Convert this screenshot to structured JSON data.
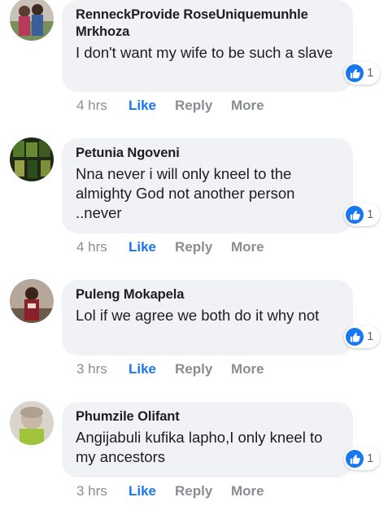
{
  "comments": [
    {
      "author": "RenneckProvide RoseUniquemunhle Mrkhoza",
      "text": "I don't want my wife to be such a slave",
      "reaction_count": "1",
      "time": "4 hrs",
      "like": "Like",
      "reply": "Reply",
      "more": "More"
    },
    {
      "author": "Petunia Ngoveni",
      "text": "Nna never i will only kneel to the almighty God not another person ..never",
      "reaction_count": "1",
      "time": "4 hrs",
      "like": "Like",
      "reply": "Reply",
      "more": "More"
    },
    {
      "author": "Puleng Mokapela",
      "text": "Lol if we agree we both do it why not",
      "reaction_count": "1",
      "time": "3 hrs",
      "like": "Like",
      "reply": "Reply",
      "more": "More"
    },
    {
      "author": "Phumzile Olifant",
      "text": "Angijabuli kufika lapho,I only kneel to my ancestors",
      "reaction_count": "1",
      "time": "3 hrs",
      "like": "Like",
      "reply": "Reply",
      "more": "More"
    }
  ],
  "colors": {
    "bubble": "#f0f2f5",
    "like_blue": "#1877f2",
    "meta_gray": "#8a8d91",
    "text": "#1c1e21"
  },
  "icons": {
    "reaction": "thumbs-up-icon",
    "avatar": "avatar"
  }
}
